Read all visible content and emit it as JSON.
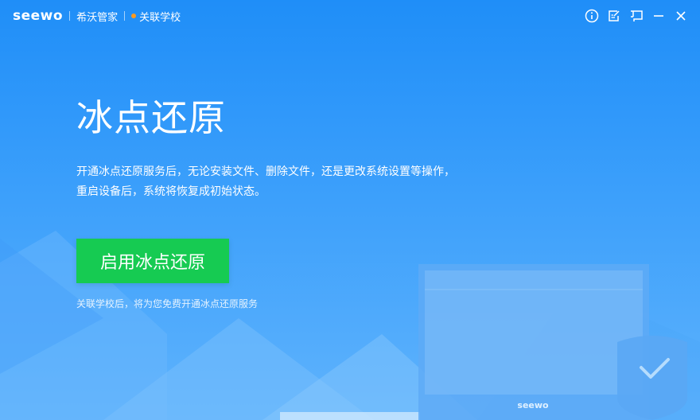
{
  "titlebar": {
    "logo": "seewo",
    "app_name": "希沃管家",
    "link_school": "关联学校",
    "dot_color": "#ff9a1f",
    "controls": [
      {
        "name": "info-icon"
      },
      {
        "name": "feedback-icon"
      },
      {
        "name": "skin-icon"
      },
      {
        "name": "minimize-icon"
      },
      {
        "name": "close-icon"
      }
    ]
  },
  "main": {
    "title": "冰点还原",
    "desc_line1": "开通冰点还原服务后，无论安装文件、删除文件，还是更改系统设置等操作，",
    "desc_line2": "重启设备后，系统将恢复成初始状态。",
    "enable_button": "启用冰点还原",
    "hint": "关联学校后，将为您免费开通冰点还原服务"
  },
  "illustration": {
    "monitor_logo": "seewo",
    "shield_icon": "check-shield-icon"
  },
  "colors": {
    "accent_green": "#16cb52",
    "background_top": "#1f8ef8",
    "background_bottom": "#5fb3fc"
  }
}
